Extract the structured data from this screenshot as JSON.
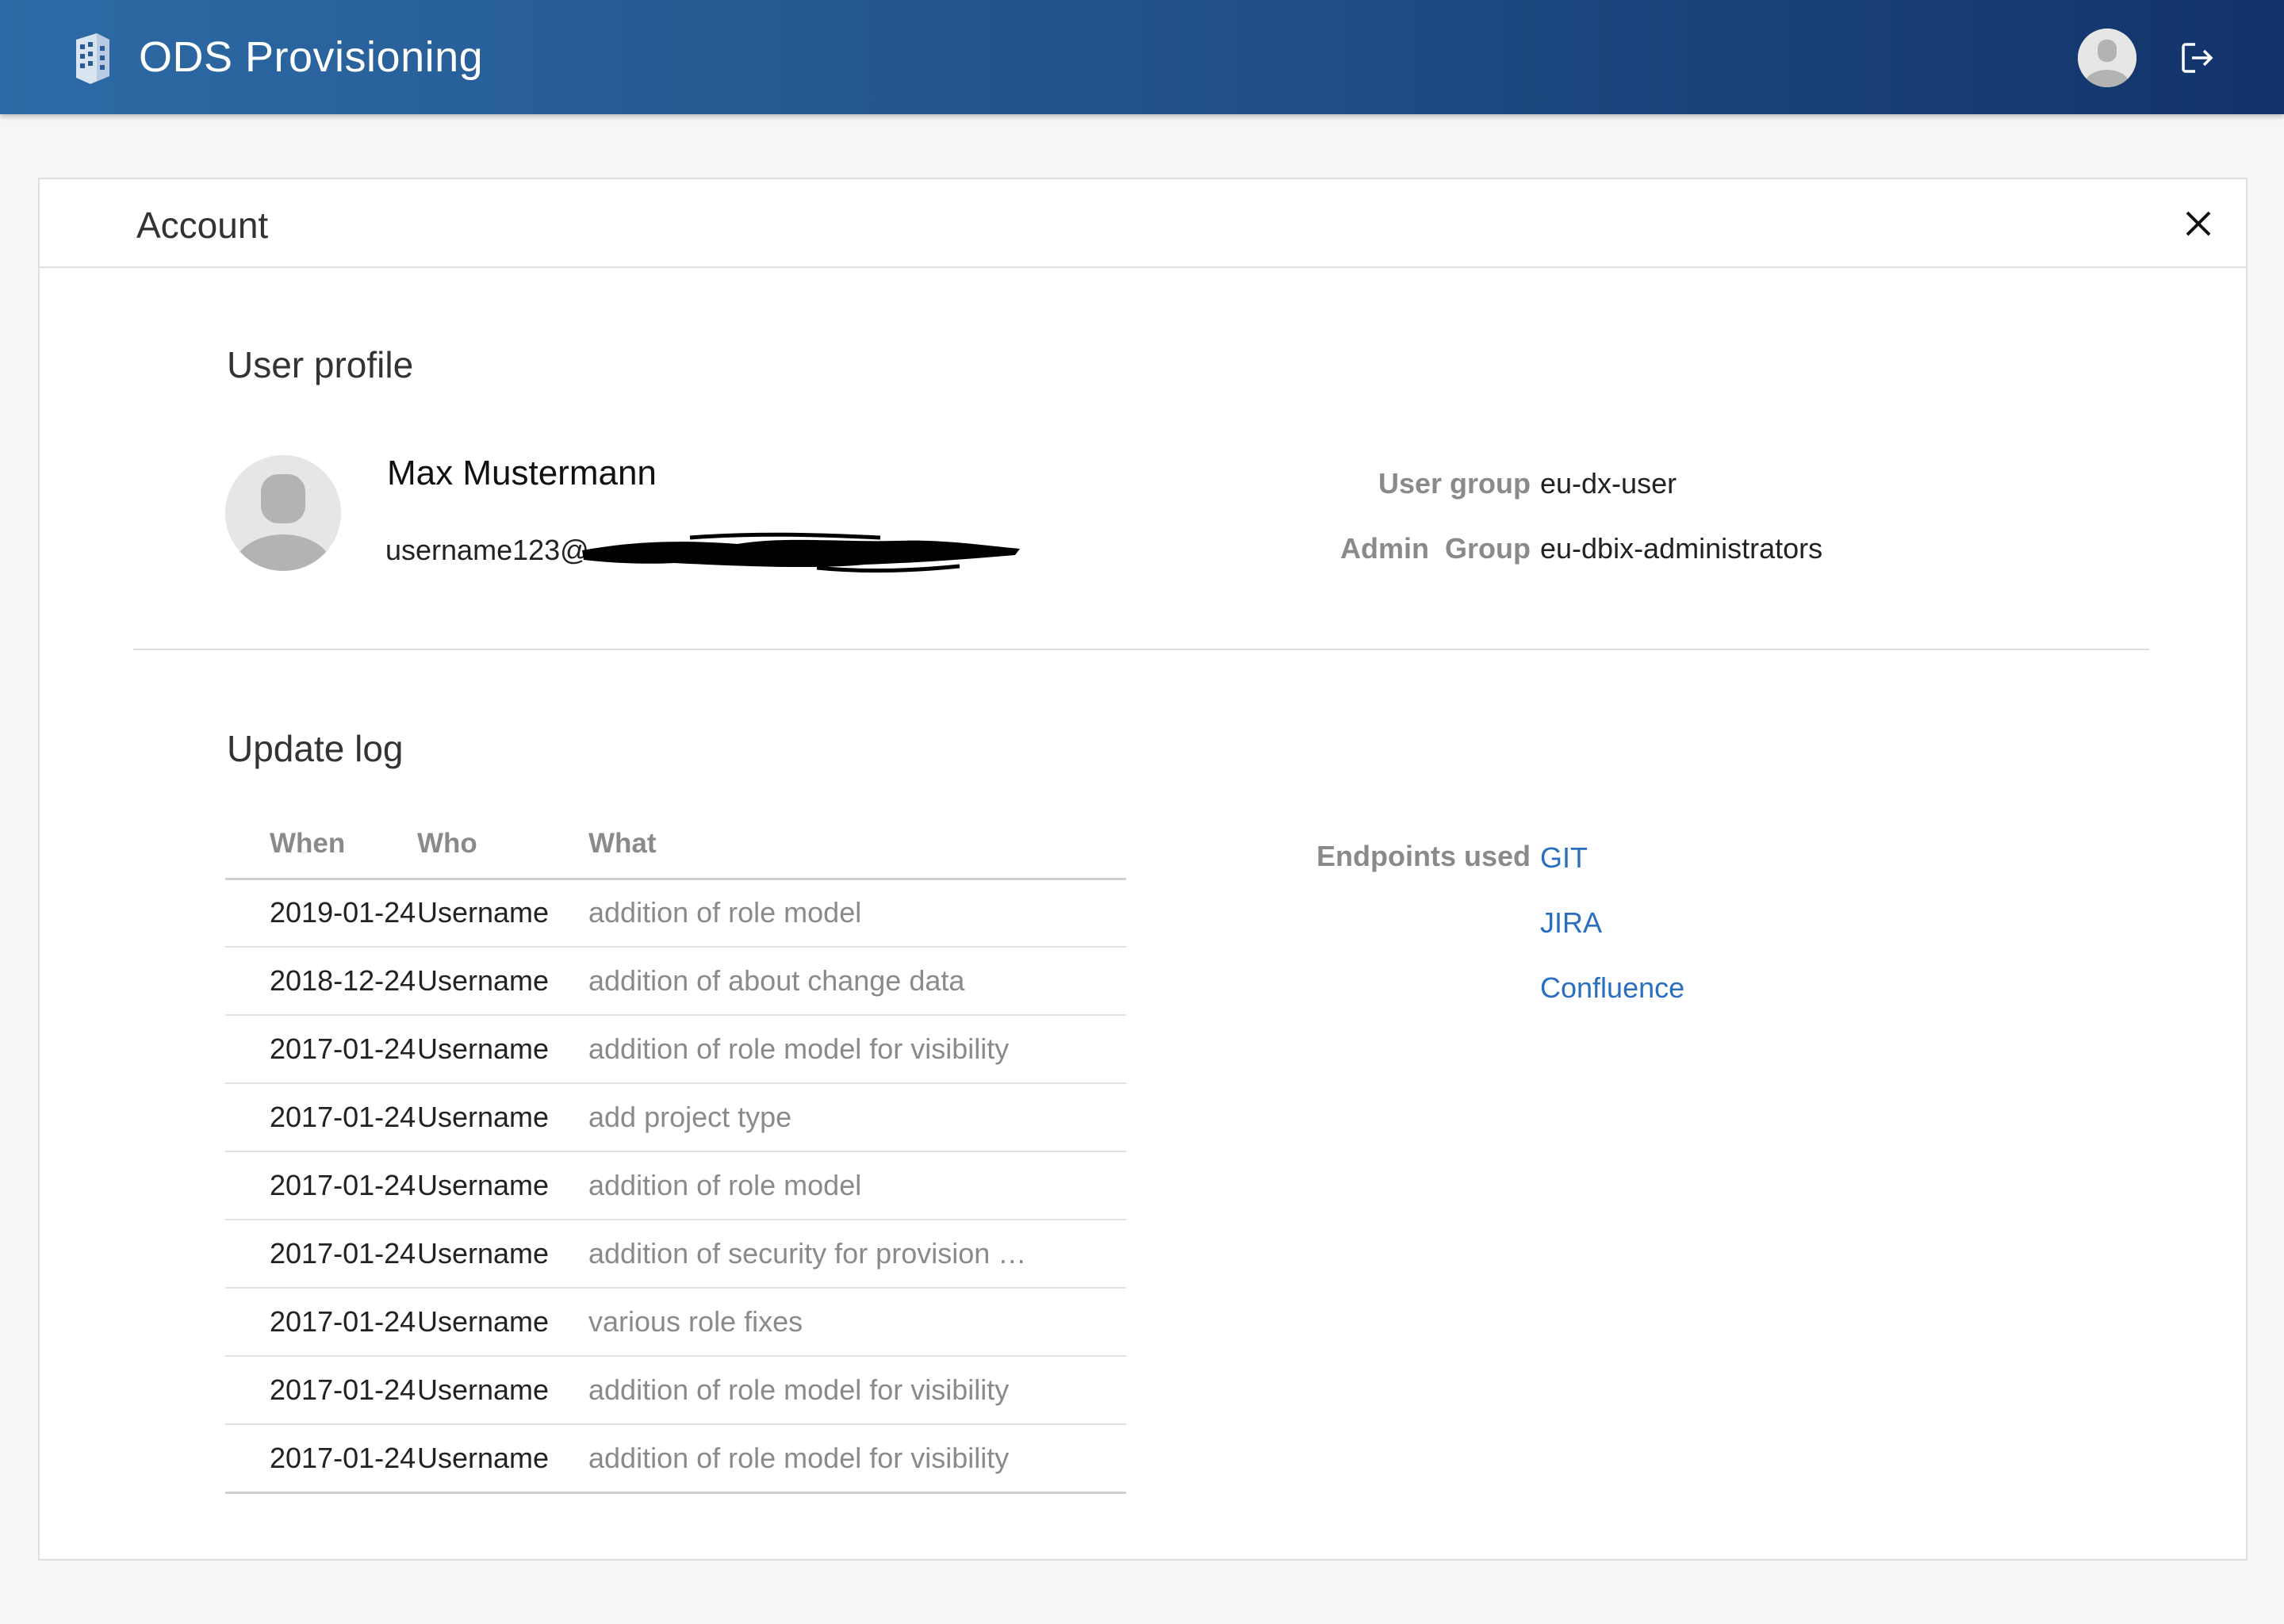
{
  "app": {
    "title": "ODS Provisioning"
  },
  "account": {
    "title": "Account"
  },
  "profile": {
    "section_title": "User profile",
    "name": "Max Mustermann",
    "email_visible": "username123@",
    "user_group_label": "User group",
    "user_group_value": "eu-dx-user",
    "admin_group_label": "Admin  Group",
    "admin_group_value": "eu-dbix-administrators"
  },
  "log": {
    "section_title": "Update log",
    "headers": [
      "When",
      "Who",
      "What"
    ],
    "rows": [
      [
        "2019-01-24",
        "Username",
        "addition of role model"
      ],
      [
        "2018-12-24",
        "Username",
        "addition of about change data"
      ],
      [
        "2017-01-24",
        "Username",
        "addition of role model for visibility"
      ],
      [
        "2017-01-24",
        "Username",
        "add project type"
      ],
      [
        "2017-01-24",
        "Username",
        "addition of role model"
      ],
      [
        "2017-01-24",
        "Username",
        "addition of security for provision …"
      ],
      [
        "2017-01-24",
        "Username",
        "various role fixes"
      ],
      [
        "2017-01-24",
        "Username",
        "addition of role model for visibility"
      ],
      [
        "2017-01-24",
        "Username",
        "addition of role model for visibility"
      ]
    ]
  },
  "endpoints": {
    "label": "Endpoints used",
    "items": [
      "GIT",
      "JIRA",
      "Confluence"
    ]
  },
  "colors": {
    "link": "#2a6ebf",
    "header_start": "#2d6aa5",
    "header_end": "#12336a"
  },
  "icons": {
    "logo": "building-logo-icon",
    "avatar": "avatar-icon",
    "logout": "logout-icon",
    "close": "close-icon"
  }
}
